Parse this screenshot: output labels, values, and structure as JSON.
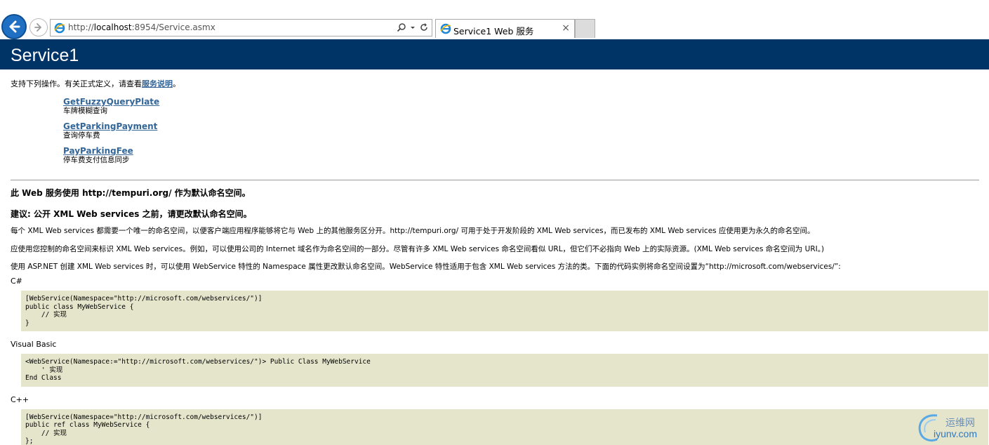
{
  "browser": {
    "url_prefix": "http://",
    "url_host": "localhost",
    "url_rest": ":8954/Service.asmx",
    "tab_title": "Service1 Web 服务",
    "tab_close": "×"
  },
  "page": {
    "title": "Service1",
    "intro_text": "支持下列操作。有关正式定义，请查看",
    "intro_link": "服务说明",
    "intro_end": "。",
    "operations": [
      {
        "name": "GetFuzzyQueryPlate",
        "description": "车牌模糊查询"
      },
      {
        "name": "GetParkingPayment",
        "description": "查询停车费"
      },
      {
        "name": "PayParkingFee",
        "description": "停车费支付信息同步"
      }
    ]
  },
  "namespace": {
    "heading1": "此 Web 服务使用 http://tempuri.org/ 作为默认命名空间。",
    "heading2": "建议: 公开 XML Web services 之前，请更改默认命名空间。",
    "para1": "每个 XML Web services 都需要一个唯一的命名空间，以便客户端应用程序能够将它与 Web 上的其他服务区分开。http://tempuri.org/ 可用于处于开发阶段的 XML Web services，而已发布的 XML Web services 应使用更为永久的命名空间。",
    "para2": "应使用您控制的命名空间来标识 XML Web services。例如，可以使用公司的 Internet 域名作为命名空间的一部分。尽管有许多 XML Web services 命名空间看似 URL，但它们不必指向 Web 上的实际资源。(XML Web services 命名空间为 URI。)",
    "para3": "使用 ASP.NET 创建 XML Web services 时，可以使用 WebService 特性的 Namespace 属性更改默认命名空间。WebService 特性适用于包含 XML Web services 方法的类。下面的代码实例将命名空间设置为“http://microsoft.com/webservices/”:",
    "samples": [
      {
        "language": "C#",
        "code": "[WebService(Namespace=\"http://microsoft.com/webservices/\")]\npublic class MyWebService {\n    // 实现\n}"
      },
      {
        "language": "Visual Basic",
        "code": "<WebService(Namespace:=\"http://microsoft.com/webservices/\")> Public Class MyWebService\n    ' 实现\nEnd Class"
      },
      {
        "language": "C++",
        "code": "[WebService(Namespace=\"http://microsoft.com/webservices/\")]\npublic ref class MyWebService {\n    // 实现\n};"
      }
    ]
  },
  "watermark": {
    "cn": "运维网",
    "en": "iyunv.com"
  },
  "colors": {
    "banner": "#003366",
    "link": "#336699",
    "code_bg": "#e5e5cc",
    "back_button": "#1f6fc2"
  }
}
